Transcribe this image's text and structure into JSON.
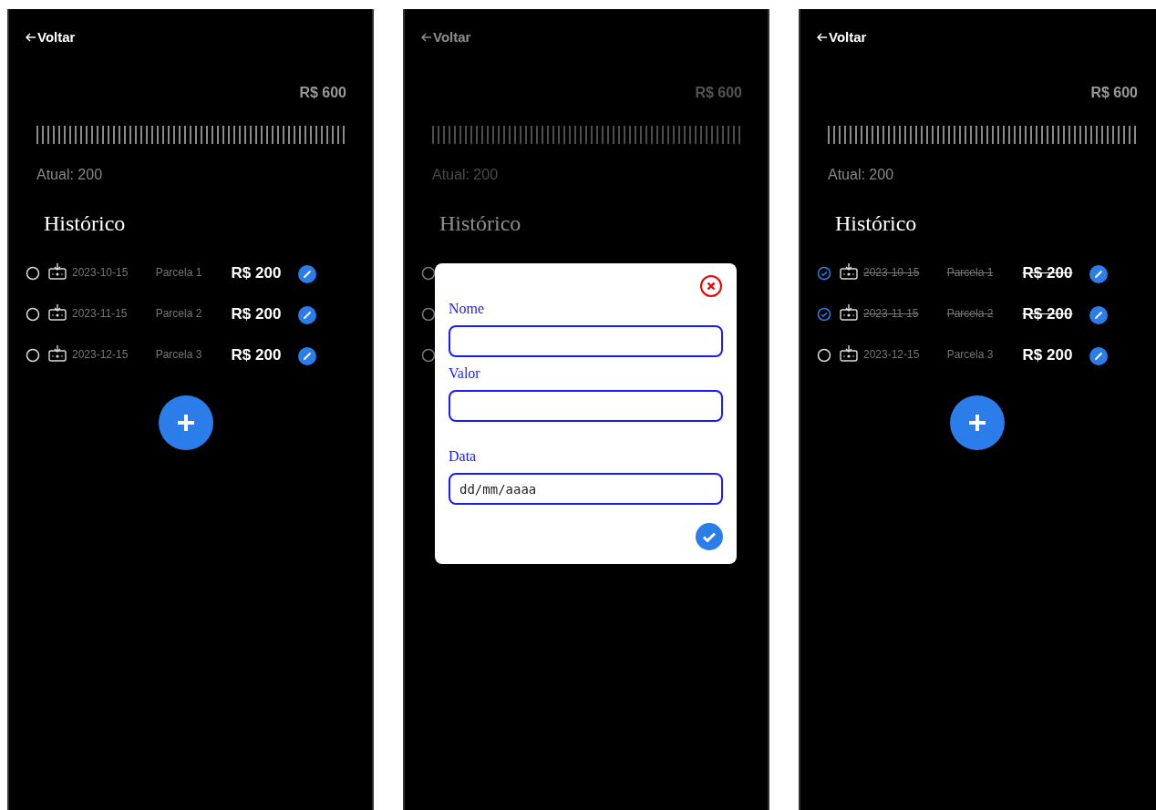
{
  "screens": [
    {
      "back": "Voltar",
      "dimmed": false,
      "total": "R$ 600",
      "current": "Atual: 200",
      "history_title": "Histórico",
      "rows": [
        {
          "checked": false,
          "date": "2023-10-15",
          "label": "Parcela 1",
          "amount": "R$ 200"
        },
        {
          "checked": false,
          "date": "2023-11-15",
          "label": "Parcela 2",
          "amount": "R$ 200"
        },
        {
          "checked": false,
          "date": "2023-12-15",
          "label": "Parcela 3",
          "amount": "R$ 200"
        }
      ],
      "add_button": true
    },
    {
      "back": "Voltar",
      "dimmed": true,
      "total": "R$ 600",
      "current": "Atual: 200",
      "history_title": "Histórico",
      "rows": [
        {
          "checked": false
        },
        {
          "checked": false
        },
        {
          "checked": false
        }
      ],
      "modal": {
        "fields": [
          {
            "label": "Nome"
          },
          {
            "label": "Valor"
          },
          {
            "label": "Data",
            "placeholder": "dd/mm/aaaa"
          }
        ]
      }
    },
    {
      "back": "Voltar",
      "dimmed": false,
      "total": "R$ 600",
      "current": "Atual: 200",
      "history_title": "Histórico",
      "rows": [
        {
          "checked": true,
          "date": "2023-10-15",
          "label": "Parcela 1",
          "amount": "R$ 200"
        },
        {
          "checked": true,
          "date": "2023-11-15",
          "label": "Parcela 2",
          "amount": "R$ 200"
        },
        {
          "checked": false,
          "date": "2023-12-15",
          "label": "Parcela 3",
          "amount": "R$ 200"
        }
      ],
      "add_button": true
    }
  ]
}
